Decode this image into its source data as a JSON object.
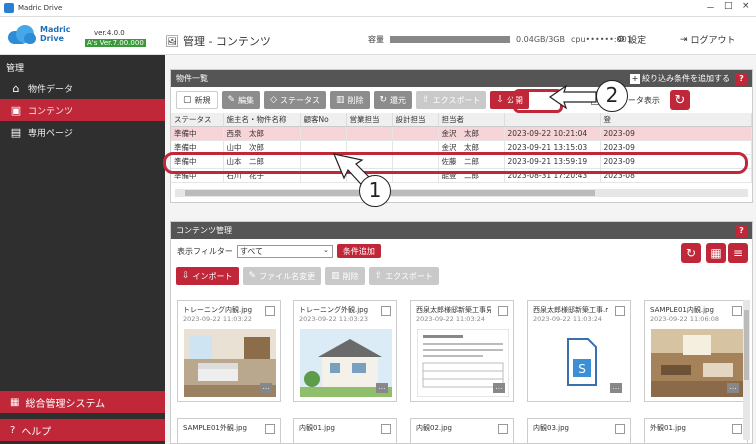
{
  "window": {
    "title": "Madric Drive",
    "minimize": "－",
    "maximize": "□",
    "close": "×"
  },
  "logo": {
    "line1": "Madric",
    "line2": "Drive",
    "version": "ver.4.0.0",
    "badge": "A's Ver.7.00.000"
  },
  "header": {
    "page_title": "管理 - コンテンツ",
    "capacity_label": "容量",
    "capacity_value": "0.04GB/3GB",
    "cpu": "cpu••••••:001",
    "settings": "設定",
    "logout": "ログアウト"
  },
  "sidebar": {
    "heading": "管理",
    "items": [
      {
        "label": "物件データ",
        "icon": "home-icon"
      },
      {
        "label": "コンテンツ",
        "icon": "image-icon"
      },
      {
        "label": "専用ページ",
        "icon": "page-icon"
      }
    ],
    "system": "総合管理システム",
    "help": "ヘルプ"
  },
  "property_panel": {
    "title": "物件一覧",
    "filter_add": "絞り込み条件を追加する",
    "help": "?",
    "buttons": {
      "new": "新規",
      "edit": "編集",
      "status": "ステータス",
      "delete": "削除",
      "restore": "還元",
      "export": "エクスポート",
      "publish": "公開"
    },
    "show_deleted": "削除データ表示",
    "columns": [
      "ステータス",
      "施主名・物件名称",
      "顧客No",
      "営業担当",
      "設計担当",
      "担当者",
      "",
      "登"
    ],
    "rows": [
      {
        "status": "準備中",
        "name": "西泉　太郎",
        "no": "",
        "sales": "",
        "design": "",
        "staff": "金沢　太郎",
        "date": "2023-09-22 10:21:04",
        "reg": "2023-09"
      },
      {
        "status": "準備中",
        "name": "山中　次郎",
        "no": "",
        "sales": "",
        "design": "",
        "staff": "金沢　太郎",
        "date": "2023-09-21 13:15:03",
        "reg": "2023-09"
      },
      {
        "status": "準備中",
        "name": "山本　二郎",
        "no": "",
        "sales": "",
        "design": "",
        "staff": "佐藤　二郎",
        "date": "2023-09-21 13:59:19",
        "reg": "2023-09"
      },
      {
        "status": "準備中",
        "name": "石川　花子",
        "no": "",
        "sales": "",
        "design": "",
        "staff": "能登　二郎",
        "date": "2023-08-31 17:20:43",
        "reg": "2023-08"
      }
    ]
  },
  "content_panel": {
    "title": "コンテンツ管理",
    "help": "?",
    "filter_label": "表示フィルター",
    "filter_value": "すべて",
    "add_condition": "条件追加",
    "buttons": {
      "import": "インポート",
      "rename": "ファイル名変更",
      "delete": "削除",
      "export": "エクスポート"
    },
    "cards": [
      {
        "name": "トレーニング内観.jpg",
        "date": "2023-09-22 11:03:22"
      },
      {
        "name": "トレーニング外観.jpg",
        "date": "2023-09-22 11:03:23"
      },
      {
        "name": "西泉太郎様邸新築工事見積",
        "date": "2023-09-22 11:03:24"
      },
      {
        "name": "西泉太郎様邸新築工事.mi",
        "date": "2023-09-22 11:03:24"
      },
      {
        "name": "SAMPLE01内観.jpg",
        "date": "2023-09-22 11:06:08"
      }
    ],
    "cards_row2": [
      "SAMPLE01外観.jpg",
      "内観01.jpg",
      "内観02.jpg",
      "内観03.jpg",
      "外観01.jpg"
    ]
  },
  "callouts": {
    "one": "1",
    "two": "2"
  },
  "colors": {
    "accent": "#c0283a",
    "sidebar": "#2f2f2f",
    "panel_header": "#555555"
  }
}
